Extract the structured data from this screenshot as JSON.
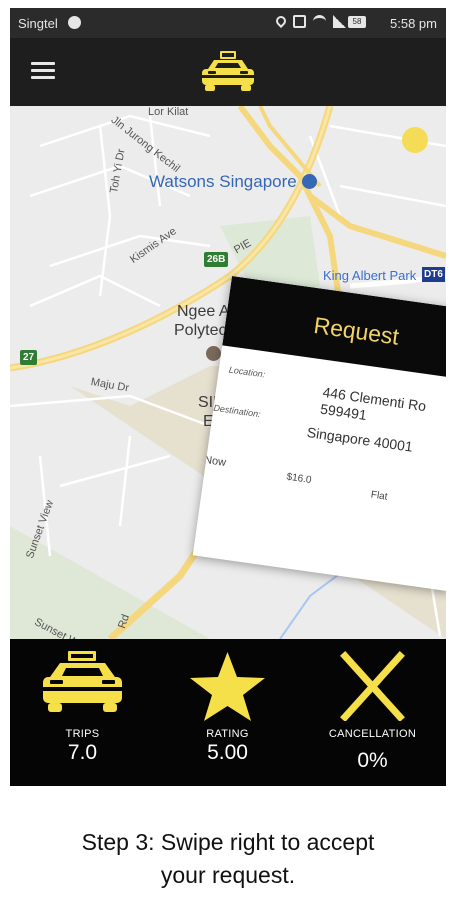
{
  "statusbar": {
    "carrier": "Singtel",
    "battery": "58",
    "time": "5:58 pm"
  },
  "appbar": {
    "logo": "taxi-logo"
  },
  "map": {
    "labels": {
      "lor_kilat": "Lor Kilat",
      "jln_jurong_kechil": "Jln Jurong Kechil",
      "toh_yi_dr": "Toh Yi Dr",
      "kismis_ave": "Kismis Ave",
      "maju_dr": "Maju Dr",
      "sunset_view": "Sunset View",
      "sunset_way": "Sunset Way",
      "rd": "Rd",
      "pie": "PIE"
    },
    "pois": {
      "watsons": "Watsons Singapore",
      "king_albert_park": "King Albert Park",
      "ngee_ann_line1": "Ngee Ann",
      "ngee_ann_line2": "Polytechnic",
      "sim_line1": "SIM G",
      "sim_line2": "E"
    },
    "signs": {
      "exit_26b": "26B",
      "exit_27": "27",
      "dt": "DT6"
    }
  },
  "request_card": {
    "title": "Request",
    "location_label": "Location:",
    "location_value_line1": "446 Clementi Ro",
    "location_value_line2": "599491",
    "destination_label": "Destination:",
    "destination_value": "Singapore 40001",
    "time": "Now",
    "fare": "$16.0",
    "fare_type": "Flat"
  },
  "stats": [
    {
      "label": "TRIPS",
      "value": "7.0",
      "icon": "taxi-icon"
    },
    {
      "label": "RATING",
      "value": "5.00",
      "icon": "star-icon"
    },
    {
      "label": "CANCELLATION",
      "value": "0%",
      "icon": "cross-icon"
    }
  ],
  "caption": {
    "line1": "Step 3: Swipe right to accept",
    "line2": "your request."
  },
  "colors": {
    "accent": "#f6e04a",
    "gold_text": "#f1d36a",
    "bar": "#050505",
    "pin": "#d93025"
  }
}
